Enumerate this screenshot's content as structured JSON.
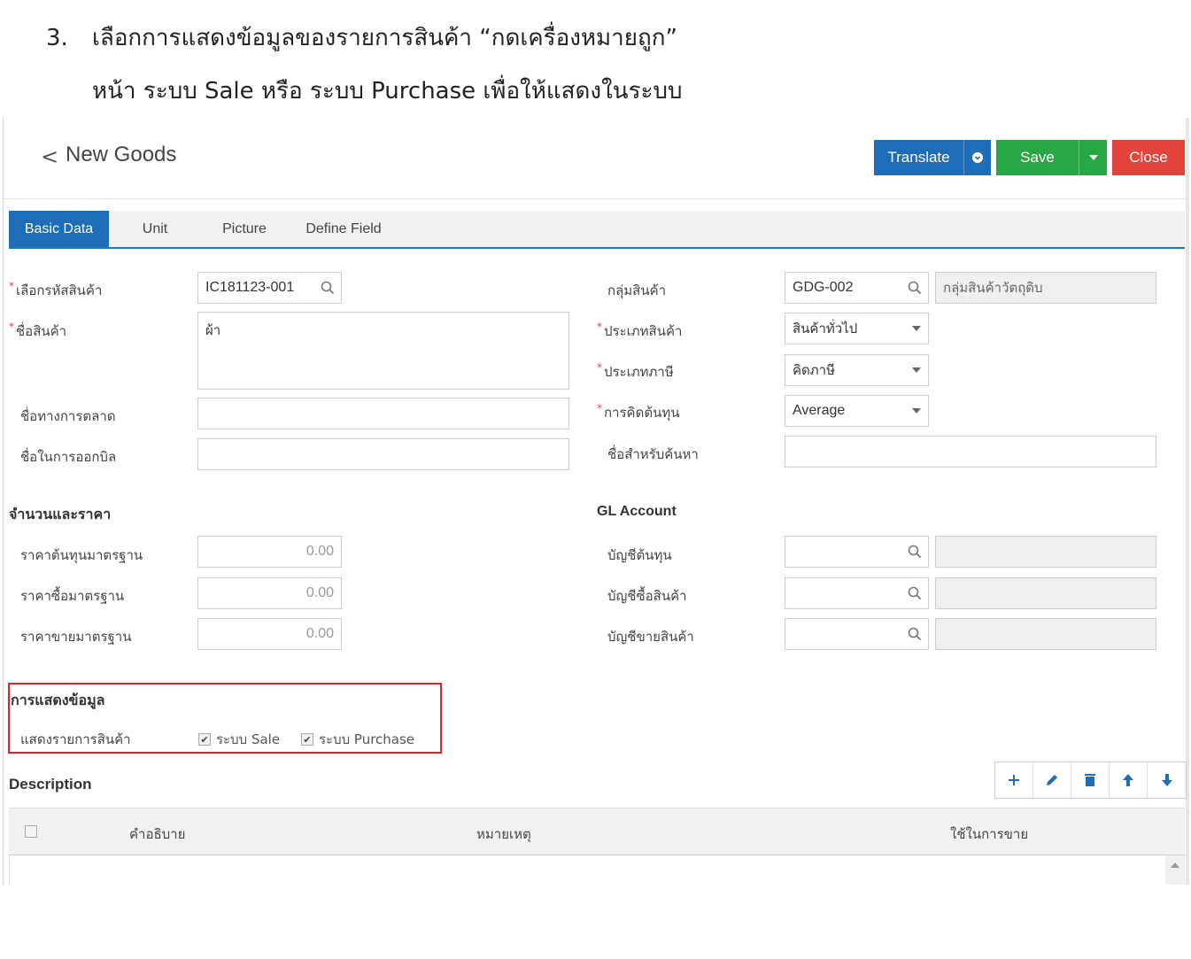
{
  "doc": {
    "step_number": "3.",
    "line1": "เลือกการแสดงข้อมูลของรายการสินค้า “กดเครื่องหมายถูก”",
    "line2": "หน้า ระบบ Sale หรือ ระบบ Purchase เพื่อให้แสดงในระบบ"
  },
  "header": {
    "back_glyph": "<",
    "title": "New Goods",
    "translate_label": "Translate",
    "save_label": "Save",
    "close_label": "Close"
  },
  "tabs": [
    {
      "label": "Basic Data",
      "active": true
    },
    {
      "label": "Unit",
      "active": false
    },
    {
      "label": "Picture",
      "active": false
    },
    {
      "label": "Define Field",
      "active": false
    }
  ],
  "basic": {
    "code_label": "เลือกรหัสสินค้า",
    "code_value": "IC181123-001",
    "name_label": "ชื่อสินค้า",
    "name_value": "ผ้า",
    "market_name_label": "ชื่อทางการตลาด",
    "market_name_value": "",
    "bill_name_label": "ชื่อในการออกบิล",
    "bill_name_value": "",
    "group_label": "กลุ่มสินค้า",
    "group_code": "GDG-002",
    "group_name": "กลุ่มสินค้าวัตถุดิบ",
    "type_label": "ประเภทสินค้า",
    "type_value": "สินค้าทั่วไป",
    "tax_label": "ประเภทภาษี",
    "tax_value": "คิดภาษี",
    "cost_label": "การคิดต้นทุน",
    "cost_value": "Average",
    "search_name_label": "ชื่อสำหรับค้นหา",
    "search_name_value": "",
    "required_mark": "*"
  },
  "qty_price": {
    "section_title": "จำนวนและราคา",
    "std_cost_label": "ราคาต้นทุนมาตรฐาน",
    "std_cost_value": "0.00",
    "std_buy_label": "ราคาซื้อมาตรฐาน",
    "std_buy_value": "0.00",
    "std_sell_label": "ราคาขายมาตรฐาน",
    "std_sell_value": "0.00"
  },
  "gl": {
    "section_title": "GL Account",
    "cost_acc_label": "บัญชีต้นทุน",
    "buy_acc_label": "บัญชีซื้อสินค้า",
    "sell_acc_label": "บัญชีขายสินค้า"
  },
  "display": {
    "section_title": "การแสดงข้อมูล",
    "show_label": "แสดงรายการสินค้า",
    "sale_label": "ระบบ Sale",
    "sale_checked": true,
    "purchase_label": "ระบบ Purchase",
    "purchase_checked": true,
    "check_glyph": "✔"
  },
  "description": {
    "section_title": "Description",
    "columns": [
      "คำอธิบาย",
      "หมายเหตุ",
      "ใช้ในการขาย"
    ],
    "toolbar_icons": [
      "plus-icon",
      "pencil-icon",
      "trash-icon",
      "arrow-up-icon",
      "arrow-down-icon"
    ]
  },
  "colors": {
    "primary": "#1e6db8",
    "success": "#28a745",
    "danger": "#e2433a",
    "highlight_border": "#e0202a"
  }
}
